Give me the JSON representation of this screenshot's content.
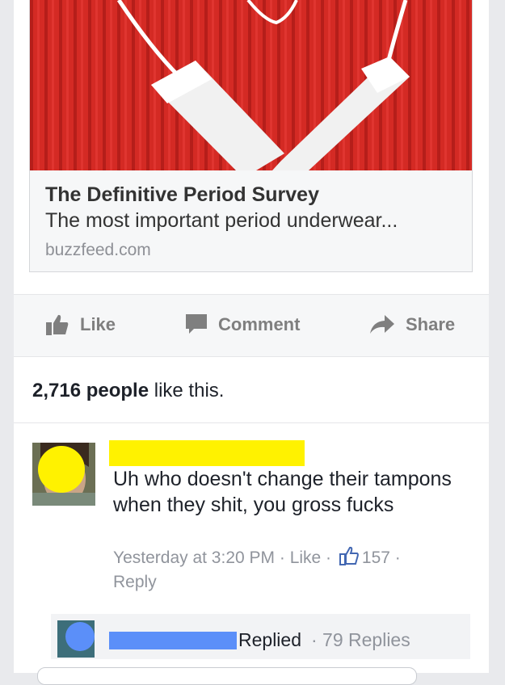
{
  "link": {
    "title": "The Definitive Period Survey",
    "description": "The most important period underwear...",
    "domain": "buzzfeed.com"
  },
  "actions": {
    "like": "Like",
    "comment": "Comment",
    "share": "Share"
  },
  "likes": {
    "count": "2,716 people",
    "suffix": " like this."
  },
  "comment": {
    "text": "Uh who doesn't change their tampons when they shit, you gross fucks",
    "time": "Yesterday at 3:20 PM",
    "sep1": " · ",
    "like_label": "Like",
    "sep2": " · ",
    "like_count": "157",
    "sep3": " · ",
    "reply_label": "Reply"
  },
  "reply": {
    "replied": "Replied",
    "count": "· 79 Replies"
  },
  "colors": {
    "brand_blue": "#4267b2",
    "redaction_yellow": "#fff200",
    "redaction_blue": "#5b8ff9",
    "image_red": "#d42a24"
  },
  "icons": [
    "thumbs-up-icon",
    "comment-bubble-icon",
    "share-arrow-icon",
    "like-count-thumb-icon"
  ]
}
